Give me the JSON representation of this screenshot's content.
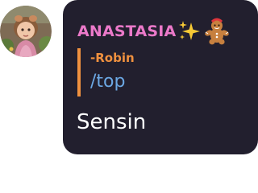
{
  "message": {
    "author": {
      "name": "ANASTASIA",
      "name_color": "#eb79c9",
      "badges": [
        "sparkles-icon",
        "gingerbread-man-icon"
      ]
    },
    "reply": {
      "author": "-Robin",
      "author_color": "#f0913f",
      "text": "/top",
      "text_color": "#6ca8e4"
    },
    "content": "Sensin",
    "bubble_color": "#221f2e"
  }
}
